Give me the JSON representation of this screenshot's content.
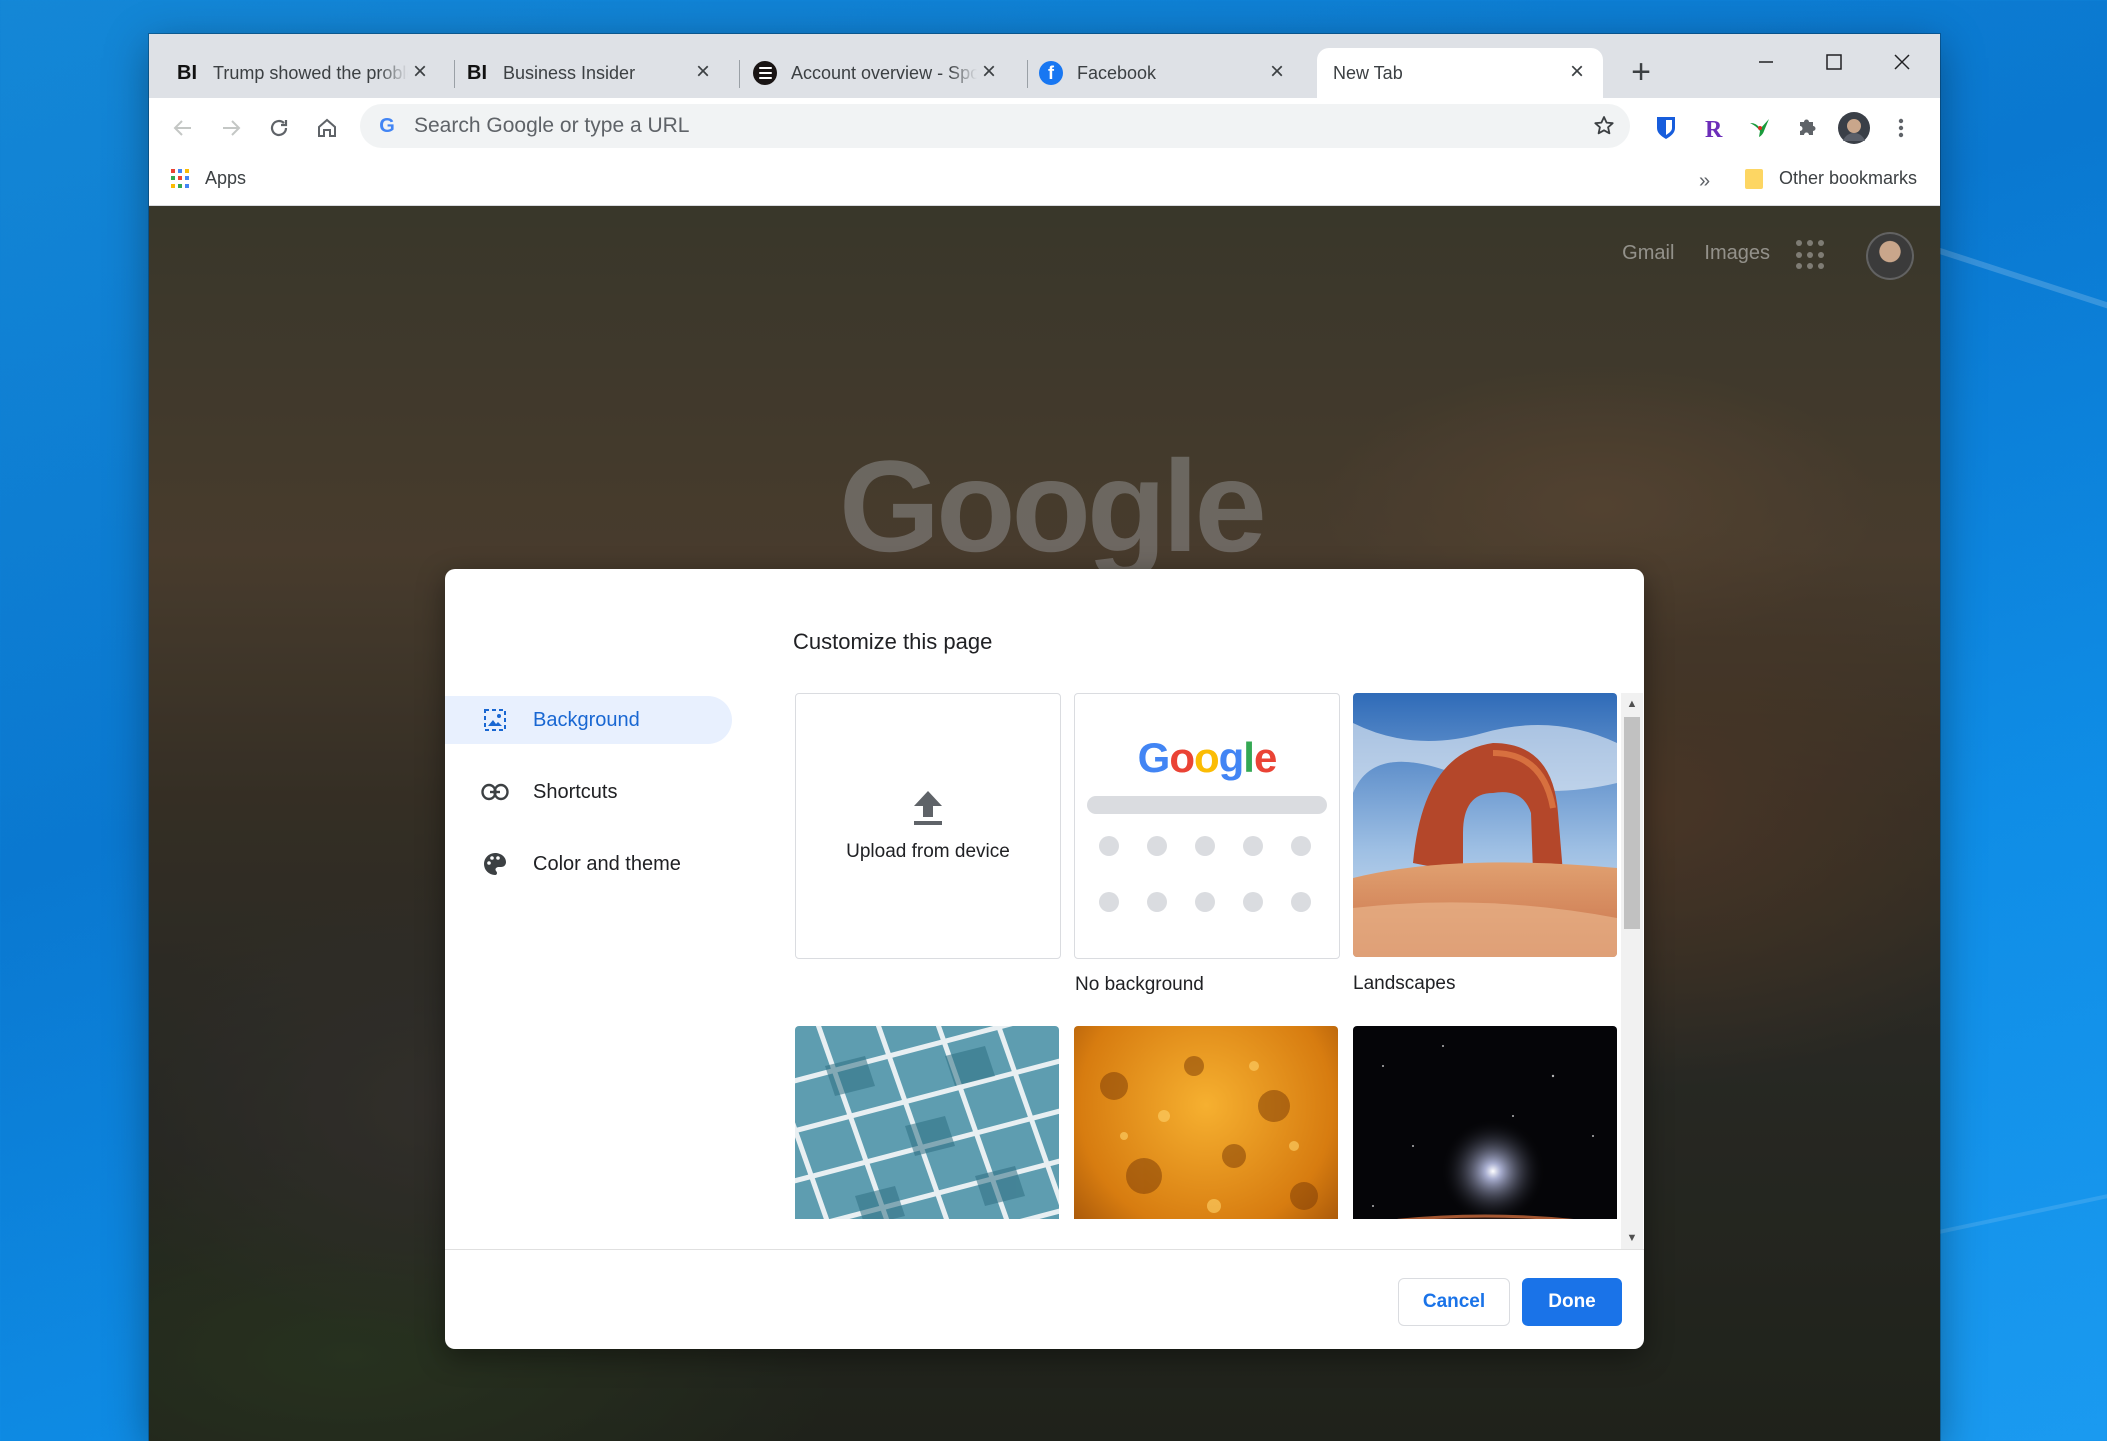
{
  "browser": {
    "tabs": [
      {
        "title": "Trump showed the problem",
        "favicon": "BI"
      },
      {
        "title": "Business Insider",
        "favicon": "BI"
      },
      {
        "title": "Account overview - Spotify",
        "favicon": "spotify-icon"
      },
      {
        "title": "Facebook",
        "favicon": "f"
      },
      {
        "title": "New Tab",
        "favicon": ""
      }
    ],
    "new_tab_symbol": "+",
    "close_symbol": "×",
    "window_controls": {
      "minimize": "—",
      "maximize": "☐",
      "close": "✕"
    }
  },
  "omnibox": {
    "placeholder": "Search Google or type a URL",
    "value": "",
    "g_glyph": "G"
  },
  "extensions": [
    "bitwarden-icon",
    "r-extension-icon",
    "bird-extension-icon",
    "puzzle-icon",
    "profile-avatar",
    "kebab-menu-icon"
  ],
  "bookmarks": {
    "apps_label": "Apps",
    "more_symbol": "»",
    "other_label": "Other bookmarks"
  },
  "ntp": {
    "links": [
      "Gmail",
      "Images"
    ],
    "logo": "Google"
  },
  "dialog": {
    "title": "Customize this page",
    "sidebar": [
      {
        "label": "Background",
        "icon": "image-icon",
        "selected": true
      },
      {
        "label": "Shortcuts",
        "icon": "link-icon",
        "selected": false
      },
      {
        "label": "Color and theme",
        "icon": "palette-icon",
        "selected": false
      }
    ],
    "tiles": {
      "upload_label": "Upload from device",
      "no_background_label": "No background",
      "no_background_logo": "Google",
      "landscapes_label": "Landscapes"
    },
    "buttons": {
      "cancel": "Cancel",
      "done": "Done"
    }
  },
  "colors": {
    "accent": "#1a73e8",
    "selected_bg": "#e8f0fe",
    "titlebar": "#dee1e6"
  }
}
